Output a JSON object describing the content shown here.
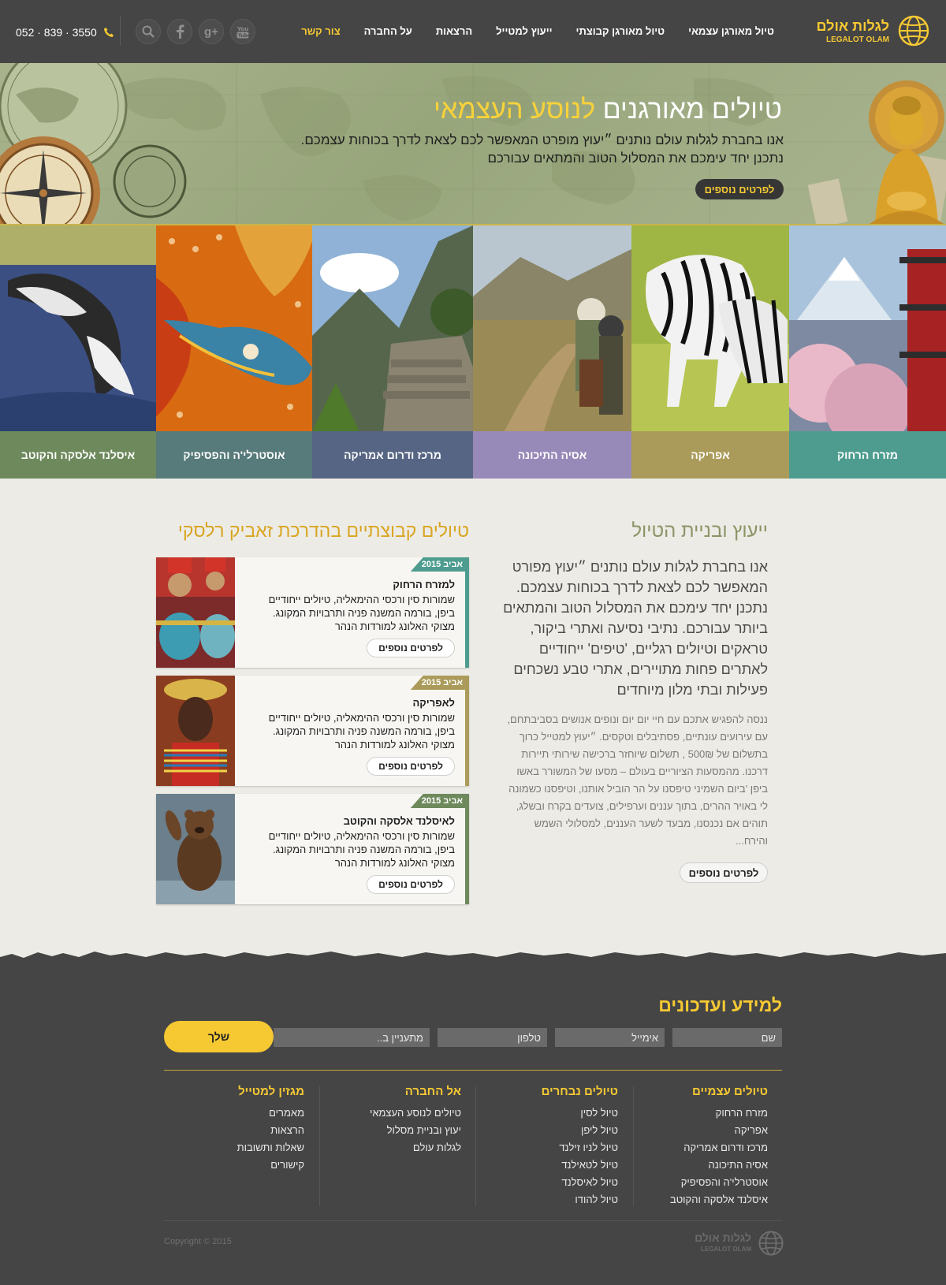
{
  "header": {
    "logo_he": "לגלות אולם",
    "logo_en": "LEGALOT OLAM",
    "nav": [
      {
        "label": "טיול מאורגן עצמאי",
        "active": false
      },
      {
        "label": "טיול מאורגן קבוצתי",
        "active": false
      },
      {
        "label": "ייעוץ למטייל",
        "active": false
      },
      {
        "label": "הרצאות",
        "active": false
      },
      {
        "label": "על החברה",
        "active": false
      },
      {
        "label": "צור קשר",
        "active": true
      }
    ],
    "phone": "052 · 839 · 3550",
    "social_icons": [
      "youtube-icon",
      "google-plus-icon",
      "facebook-icon",
      "search-icon"
    ]
  },
  "hero": {
    "title_main": "טיולים מאורגנים",
    "title_highlight": "לנוסע העצמאי",
    "text_line1": "אנו בחברת לגלות עולם נותנים ״יעוץ מופרט המאפשר לכם לצאת לדרך בכוחות עצמכם.",
    "text_line2": "נתכנן יחד עימכם את המסלול הטוב והמתאים עבורכם",
    "button": "לפרטים נוספים"
  },
  "regions": [
    {
      "label": "מזרח הרחוק",
      "color": "#4e9c8f"
    },
    {
      "label": "אפריקה",
      "color": "#ab9b5a"
    },
    {
      "label": "אסיה התיכונה",
      "color": "#988ab8"
    },
    {
      "label": "מרכז ודרום אמריקה",
      "color": "#566583"
    },
    {
      "label": "אוסטרלי'ה והפסיפיק",
      "color": "#577a7a"
    },
    {
      "label": "איסלנד אלסקה והקוטב",
      "color": "#6e8a5c"
    }
  ],
  "consult": {
    "title": "ייעוץ ובניית הטיול",
    "lead": "אנו בחברת לגלות עולם נותנים ״יעוץ מפורט המאפשר לכם לצאת לדרך בכוחות עצמכם. נתכנן יחד עימכם את המסלול הטוב והמתאים ביותר עבורכם. נתיבי נסיעה ואתרי ביקור, טראקים וטיולים רגליים, 'טיפים' ייחודיים לאתרים פחות מתויירים, אתרי טבע נשכחים פעילות ובתי מלון מיוחדים",
    "body": "ננסה להפגיש אתכם עם חיי יום יום ונופים אנושים בסביבתחם, עם עירועים עונתיים, פסתיבלים וטקסים. ״יעוץ למטייל כרוך בתשלום של 500₪ , תשלום שיוחזר ברכישה שירותי תיירות דרכנו. מהמסעות הציוריים בעולם – מסעו של המשורר באשו ביפן 'ביום השמיני טיפסנו על הר הוביל אותנו, וטיפסנו כשמונה לי באויר ההרים, בתוך עננים וערפילים, צועדים בקרח ובשלג, תוהים אם נכנסנו, מבעד לשער העננים, למסלולי השמש והירח...",
    "button": "לפרטים נוספים"
  },
  "groups": {
    "title": "טיולים קבוצתיים בהדרכת זאביק רלסקי",
    "tours": [
      {
        "badge": "אביב 2015",
        "title": "למזרח הרחוק",
        "desc": "שמורות סין ורכסי ההימאליה, טיולים ייחודיים ביפן, בורמה המשנה פניה ותרבויות המקונג. מצוקי האלונג למורדות הנהר",
        "button": "לפרטים נוספים",
        "color": "#4e9c8f"
      },
      {
        "badge": "אביב 2015",
        "title": "לאפריקה",
        "desc": "שמורות סין ורכסי ההימאליה, טיולים ייחודיים ביפן, בורמה המשנה פניה ותרבויות המקונג. מצוקי האלונג למורדות הנהר",
        "button": "לפרטים נוספים",
        "color": "#ab9b5a"
      },
      {
        "badge": "אביב 2015",
        "title": "לאיסלנד אלסקה והקוטב",
        "desc": "שמורות סין ורכסי ההימאליה, טיולים ייחודיים ביפן, בורמה המשנה פניה ותרבויות המקונג. מצוקי האלונג למורדות הנהר",
        "button": "לפרטים נוספים",
        "color": "#6e8a5c"
      }
    ]
  },
  "newsletter": {
    "title": "למידע ועדכונים",
    "fields": {
      "name": "שם",
      "email": "אימייל",
      "phone": "טלפון",
      "interest": "מתעניין ב.."
    },
    "send": "שלך"
  },
  "footer_cols": [
    {
      "title": "טיולים עצמיים",
      "items": [
        "מזרח הרחוק",
        "אפריקה",
        "מרכז ודרום אמריקה",
        "אסיה התיכונה",
        "אוסטרלי'ה והפסיפיק",
        "איסלנד אלסקה והקוטב"
      ]
    },
    {
      "title": "טיולים נבחרים",
      "items": [
        "טיול לסין",
        "טיול ליפן",
        "טיול לניו זילנד",
        "טיול לטאילנד",
        "טיול לאיסלנד",
        "טיול להודו"
      ]
    },
    {
      "title": "אל החברה",
      "items": [
        "טיולים לנוסע העצמאי",
        "יעוץ ובניית מסלול",
        "לגלות עולם"
      ]
    },
    {
      "title": "מגזין למטייל",
      "items": [
        "מאמרים",
        "הרצאות",
        "שאלות ותשובות",
        "קישורים"
      ]
    }
  ],
  "footer": {
    "logo_he": "לגלות אולם",
    "logo_en": "LEGALOT OLAM",
    "copyright": "Copyright © 2015"
  }
}
